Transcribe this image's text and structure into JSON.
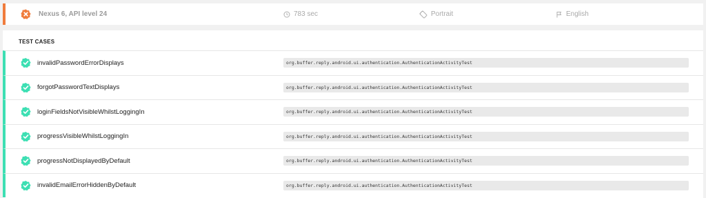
{
  "device": {
    "name": "Nexus 6, API level 24",
    "duration": "783 sec",
    "orientation": "Portrait",
    "locale": "English",
    "status": "failed",
    "status_color": "#f07c3c"
  },
  "test_cases": {
    "title": "TEST CASES",
    "pass_color": "#3ddfb3",
    "rows": [
      {
        "name": "invalidPasswordErrorDisplays",
        "class": "org.buffer.reply.android.ui.authentication.AuthenticationActivityTest",
        "status": "passed"
      },
      {
        "name": "forgotPasswordTextDisplays",
        "class": "org.buffer.reply.android.ui.authentication.AuthenticationActivityTest",
        "status": "passed"
      },
      {
        "name": "loginFieldsNotVisibleWhilstLoggingIn",
        "class": "org.buffer.reply.android.ui.authentication.AuthenticationActivityTest",
        "status": "passed"
      },
      {
        "name": "progressVisibleWhilstLoggingIn",
        "class": "org.buffer.reply.android.ui.authentication.AuthenticationActivityTest",
        "status": "passed"
      },
      {
        "name": "progressNotDisplayedByDefault",
        "class": "org.buffer.reply.android.ui.authentication.AuthenticationActivityTest",
        "status": "passed"
      },
      {
        "name": "invalidEmailErrorHiddenByDefault",
        "class": "org.buffer.reply.android.ui.authentication.AuthenticationActivityTest",
        "status": "passed"
      }
    ]
  },
  "icons": {
    "fail": "fail-badge-icon",
    "pass": "check-badge-icon",
    "duration": "clock-icon",
    "orientation": "orientation-icon",
    "locale": "flag-icon"
  }
}
